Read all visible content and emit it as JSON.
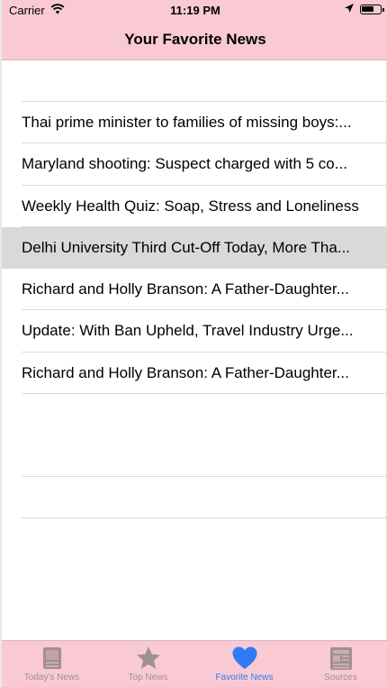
{
  "status_bar": {
    "carrier": "Carrier",
    "time": "11:19 PM",
    "battery_level_pct": 70
  },
  "nav": {
    "title": "Your Favorite News"
  },
  "news": {
    "items": [
      "Thai prime minister to families of missing boys:...",
      "Maryland shooting: Suspect charged with 5 co...",
      "Weekly Health Quiz: Soap, Stress and Loneliness",
      "Delhi University Third Cut-Off Today, More Tha...",
      "Richard and Holly Branson: A Father-Daughter...",
      "Update: With Ban Upheld, Travel Industry Urge...",
      "Richard and Holly Branson: A Father-Daughter..."
    ],
    "selected_index": 3
  },
  "tabs": [
    {
      "label": "Today's News",
      "icon": "newspaper-icon"
    },
    {
      "label": "Top News",
      "icon": "star-icon"
    },
    {
      "label": "Favorite News",
      "icon": "heart-icon"
    },
    {
      "label": "Sources",
      "icon": "sources-icon"
    }
  ],
  "active_tab": 2,
  "colors": {
    "bar_background": "#f9cad3",
    "active_tab": "#2f7bf5",
    "inactive_tab": "#a08f93",
    "selected_row": "#d9d9d9"
  }
}
